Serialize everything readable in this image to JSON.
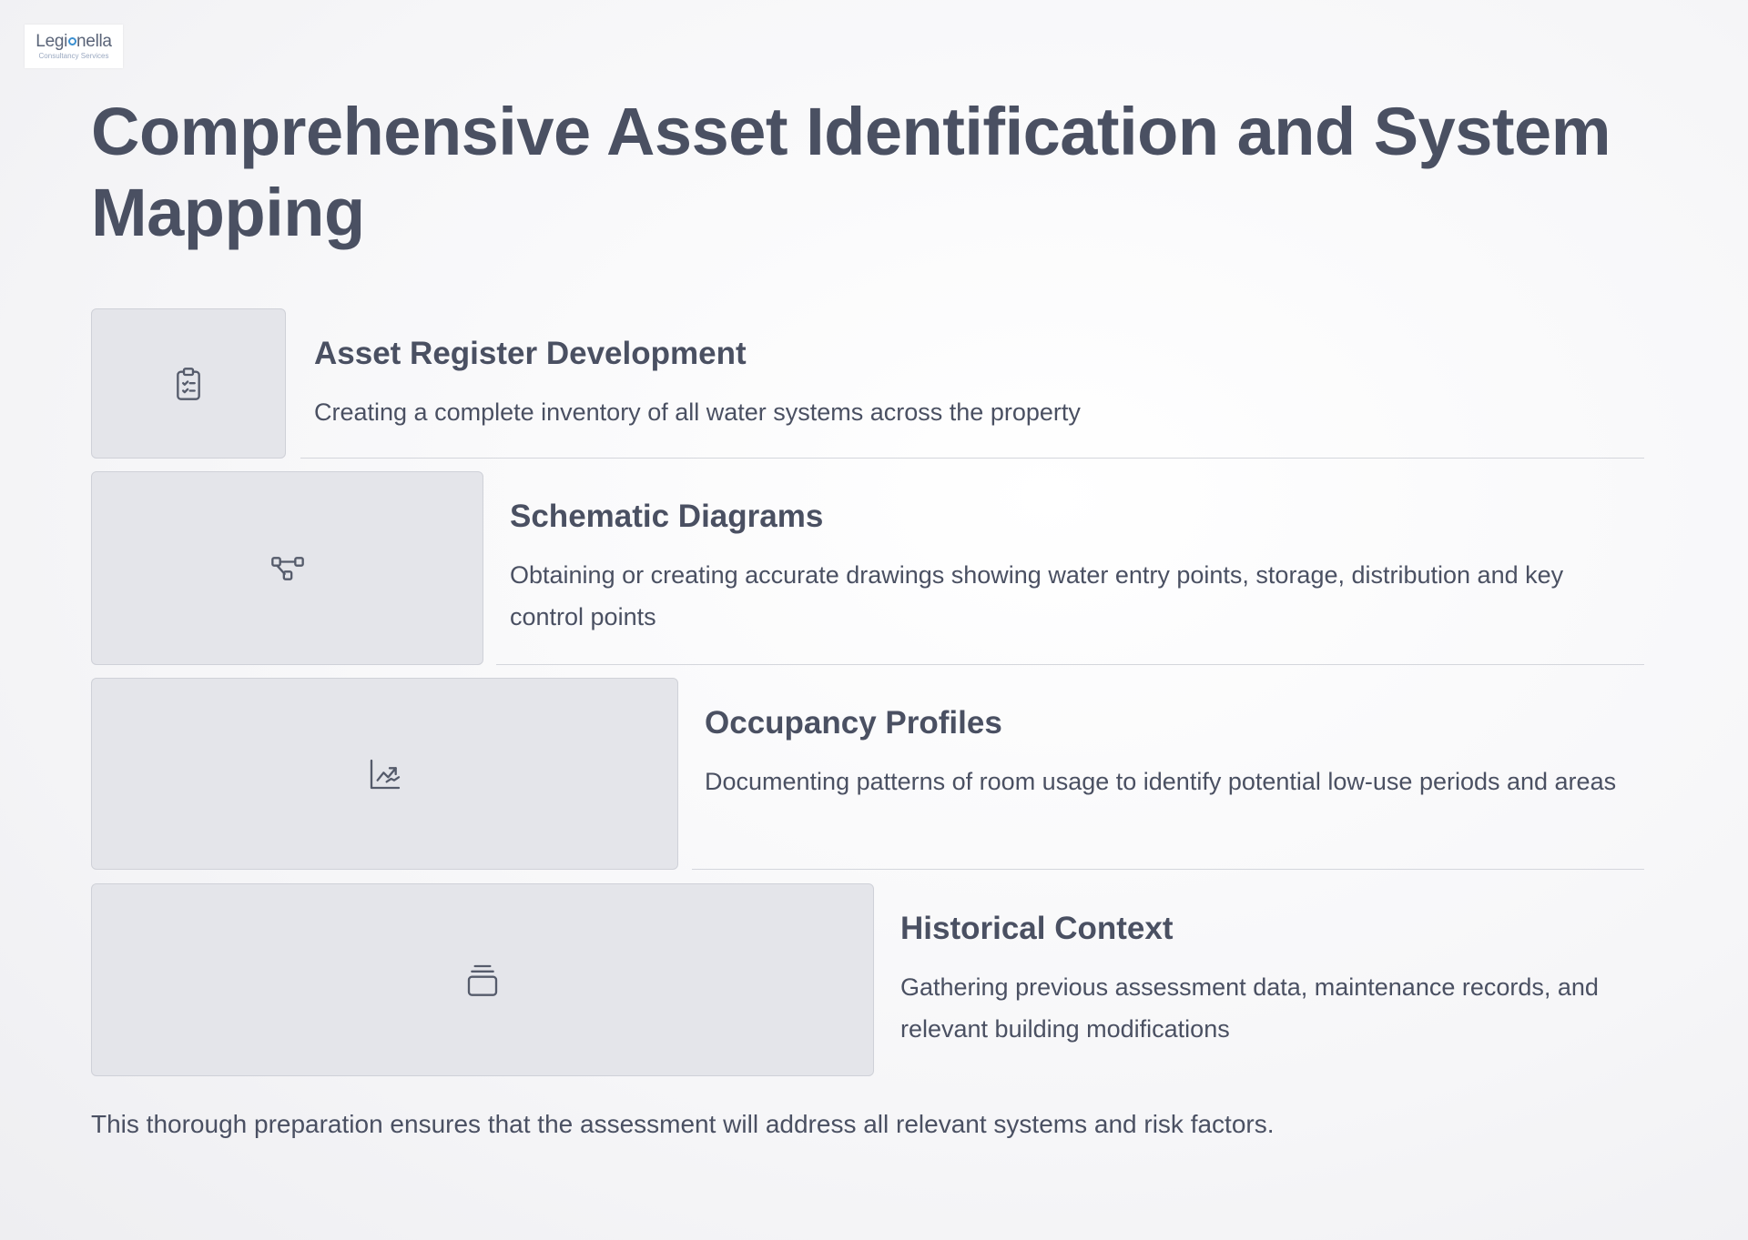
{
  "logo": {
    "name_before": "Legi",
    "name_after": "nella",
    "tagline": "Consultancy Services"
  },
  "page_title": "Comprehensive Asset Identification and System Mapping",
  "items": [
    {
      "icon": "clipboard-check-icon",
      "title": "Asset Register Development",
      "description": "Creating a complete inventory of all water systems across the property"
    },
    {
      "icon": "network-nodes-icon",
      "title": "Schematic Diagrams",
      "description": "Obtaining or creating accurate drawings showing water entry points, storage, distribution and key control points"
    },
    {
      "icon": "trend-chart-icon",
      "title": "Occupancy Profiles",
      "description": "Documenting patterns of room usage to identify potential low-use periods and areas"
    },
    {
      "icon": "stacked-folders-icon",
      "title": "Historical Context",
      "description": "Gathering previous assessment data, maintenance records, and relevant building modifications"
    }
  ],
  "footer": "This thorough preparation ensures that the assessment will address all relevant systems and risk factors.",
  "colors": {
    "text": "#4a5062",
    "card_bg": "#e4e5ea",
    "card_border": "#cfd1d8",
    "logo_accent": "#3b8fd0"
  }
}
